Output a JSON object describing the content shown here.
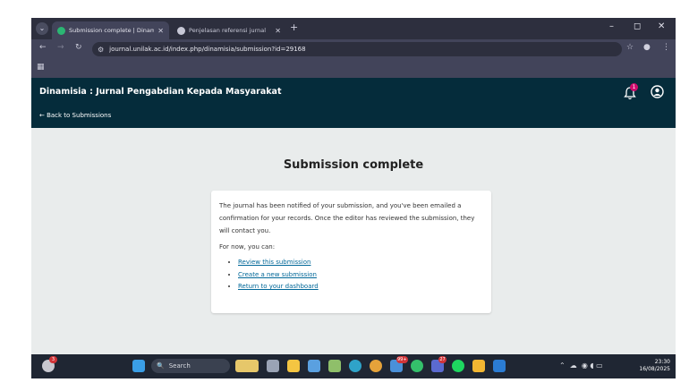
{
  "browser": {
    "tabs": [
      {
        "title": "Submission complete | Dinamisia",
        "active": true
      },
      {
        "title": "Penjelasan referensi jurnal",
        "active": false
      }
    ],
    "url": "journal.unilak.ac.id/index.php/dinamisia/submission?id=29168"
  },
  "header": {
    "site_title": "Dinamisia : Jurnal Pengabdian Kepada Masyarakat",
    "back_link": "← Back to Submissions",
    "notification_count": "1"
  },
  "main": {
    "heading": "Submission complete",
    "message": "The journal has been notified of your submission, and you've been emailed a confirmation for your records. Once the editor has reviewed the submission, they will contact you.",
    "lead": "For now, you can:",
    "links": [
      {
        "label": "Review this submission"
      },
      {
        "label": "Create a new submission"
      },
      {
        "label": "Return to your dashboard"
      }
    ]
  },
  "taskbar": {
    "search_placeholder": "Search",
    "weather_badge": "3",
    "badge_a": "99+",
    "badge_b": "27",
    "time": "23:30",
    "date": "16/08/2025"
  },
  "colors": {
    "header_bg": "#052c3b",
    "link": "#006798",
    "page_bg": "#e9ecec"
  }
}
